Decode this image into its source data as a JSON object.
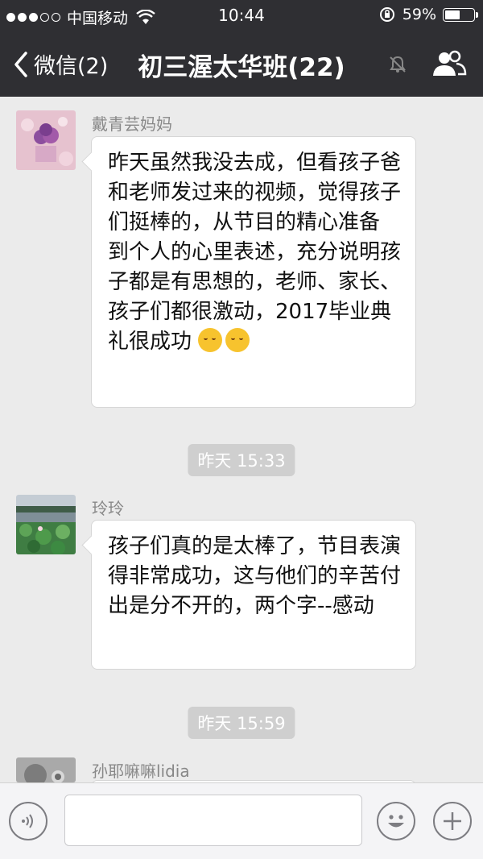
{
  "status_bar": {
    "carrier": "中国移动",
    "time": "10:44",
    "battery": "59%",
    "battery_level": 0.59
  },
  "nav": {
    "back_label": "微信(2)",
    "title": "初三渥太华班(22)"
  },
  "messages": [
    {
      "sender": "戴青芸妈妈",
      "text": "昨天虽然我没去成，但看孩子爸和老师发过来的视频，觉得孩子们挺棒的，从节目的精心准备 到个人的心里表述，充分说明孩子都是有思想的，老师、家长、孩子们都很激动，2017毕业典礼很成功",
      "emoji_count": 2,
      "emoji": "hugging-face-icon"
    },
    {
      "sender": "玲玲",
      "text": "孩子们真的是太棒了，节目表演得非常成功，这与他们的辛苦付出是分不开的，两个字--感动"
    },
    {
      "sender": "孙耶嘛嘛lidia",
      "text": ""
    }
  ],
  "timestamps": [
    "昨天 15:33",
    "昨天 15:59"
  ],
  "input": {
    "value": ""
  },
  "colors": {
    "header_bg": "#2f2f33",
    "chat_bg": "#ebebeb",
    "bubble_bg": "#ffffff",
    "time_pill": "#cfcfcf"
  }
}
